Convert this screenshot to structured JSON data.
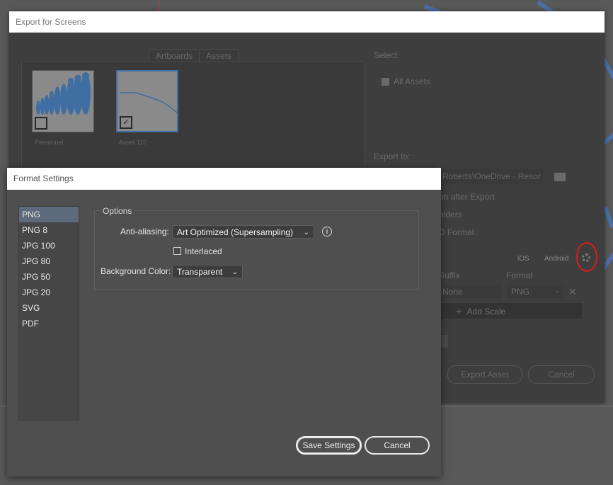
{
  "export_dialog": {
    "title": "Export for Screens",
    "tabs": [
      "Artboards",
      "Assets"
    ],
    "assets": [
      {
        "label": "Personnel",
        "checked": false
      },
      {
        "label": "Asset 110",
        "checked": true
      }
    ],
    "select_label": "Select:",
    "all_assets_label": "All Assets",
    "export_to_label": "Export to:",
    "export_path": "Roberts\\OneDrive - Resor",
    "options": [
      "on after Export",
      "olders",
      "D Format"
    ],
    "presets": [
      "iOS",
      "Android"
    ],
    "scale_headers": {
      "suffix": "Suffix",
      "format": "Format"
    },
    "scale_row": {
      "suffix": "None",
      "format": "PNG"
    },
    "add_scale_label": "Add Scale",
    "export_button": "Export Asset",
    "cancel_button": "Cancel"
  },
  "format_dialog": {
    "title": "Format Settings",
    "formats": [
      "PNG",
      "PNG 8",
      "JPG 100",
      "JPG 80",
      "JPG 50",
      "JPG 20",
      "SVG",
      "PDF"
    ],
    "selected_format": "PNG",
    "options_title": "Options",
    "anti_aliasing_label": "Anti-aliasing:",
    "anti_aliasing_value": "Art Optimized (Supersampling)",
    "interlaced_label": "Interlaced",
    "interlaced_checked": false,
    "background_color_label": "Background Color:",
    "background_color_value": "Transparent",
    "save_button": "Save Settings",
    "cancel_button": "Cancel"
  },
  "colors": {
    "selection": "#5d6a7b",
    "asset_border": "#3f6ea3",
    "annotation_red": "#d81d1d"
  }
}
